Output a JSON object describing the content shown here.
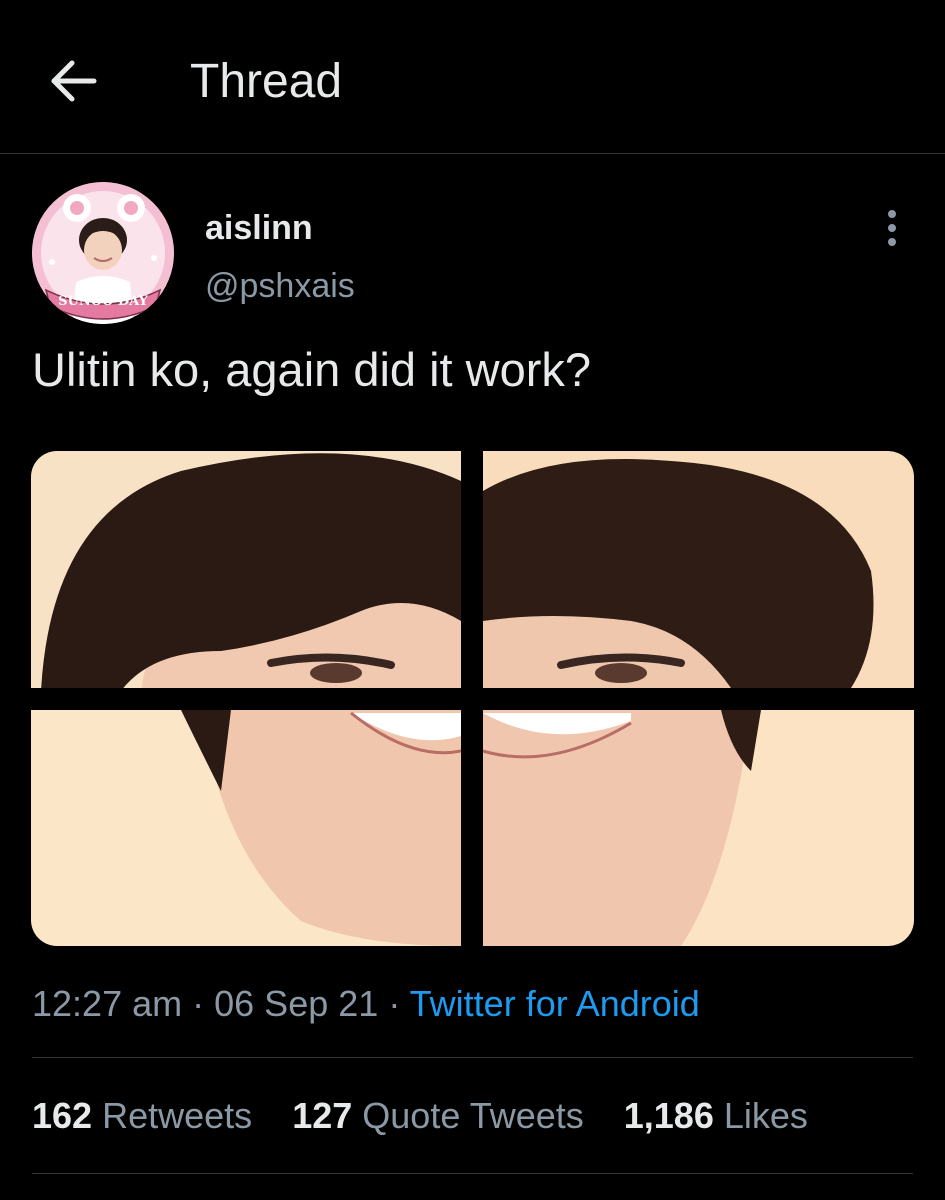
{
  "header": {
    "title": "Thread",
    "back_icon": "arrow-left-icon"
  },
  "tweet": {
    "author": {
      "display_name": "aislinn",
      "handle": "@pshxais",
      "avatar_text": "SUNOO DAY"
    },
    "text": "Ulitin ko, again did it work?",
    "more_icon": "more-vertical-icon",
    "time": "12:27 am",
    "date": "06 Sep 21",
    "separator": "·",
    "source": "Twitter for Android",
    "stats": {
      "retweets": {
        "count": "162",
        "label": "Retweets"
      },
      "quote_tweets": {
        "count": "127",
        "label": "Quote Tweets"
      },
      "likes": {
        "count": "1,186",
        "label": "Likes"
      }
    }
  },
  "colors": {
    "background": "#000000",
    "text": "#e7e9ea",
    "secondary_text": "#8b98a5",
    "link": "#1d9bf0",
    "divider": "#2f3336"
  }
}
